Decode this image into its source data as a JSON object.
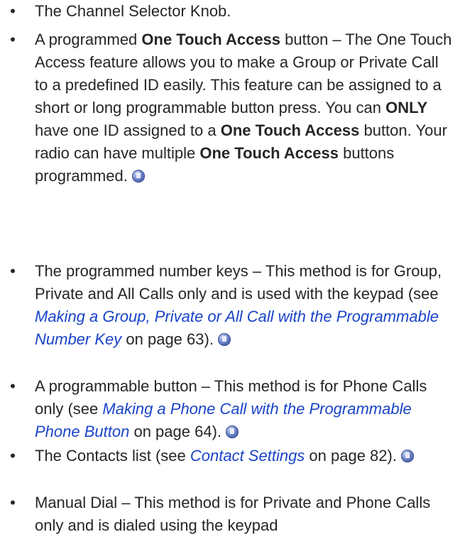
{
  "bullet_char": "•",
  "items": [
    {
      "segments": [
        {
          "t": "n",
          "text": "The Channel Selector Knob."
        }
      ],
      "icon": false
    },
    {
      "segments": [
        {
          "t": "n",
          "text": "A programmed "
        },
        {
          "t": "b",
          "text": "One Touch Access"
        },
        {
          "t": "n",
          "text": " button – The One Touch Access feature allows you to make a Group or Private Call to a predefined ID easily. This feature can be assigned to a short or long programmable button press. You can "
        },
        {
          "t": "b",
          "text": "ONLY"
        },
        {
          "t": "n",
          "text": " have one ID assigned to a "
        },
        {
          "t": "b",
          "text": "One Touch Access"
        },
        {
          "t": "n",
          "text": " button. Your radio can have multiple "
        },
        {
          "t": "b",
          "text": "One Touch Access"
        },
        {
          "t": "n",
          "text": " buttons programmed."
        }
      ],
      "icon": true
    },
    {
      "segments": [
        {
          "t": "n",
          "text": "The programmed number keys – This method is for Group, Private and All Calls only and is used with the keypad (see "
        },
        {
          "t": "l",
          "text": "Making a Group, Private or All Call with the Programmable Number Key"
        },
        {
          "t": "n",
          "text": " on page 63)."
        }
      ],
      "icon": true
    },
    {
      "segments": [
        {
          "t": "n",
          "text": "A programmable button – This method is for Phone Calls only (see "
        },
        {
          "t": "l",
          "text": "Making a Phone Call with the Programmable Phone Button"
        },
        {
          "t": "n",
          "text": " on page 64)."
        }
      ],
      "icon": true
    },
    {
      "segments": [
        {
          "t": "n",
          "text": "The Contacts list (see "
        },
        {
          "t": "l",
          "text": "Contact Settings"
        },
        {
          "t": "n",
          "text": " on page 82)."
        }
      ],
      "icon": true
    },
    {
      "segments": [
        {
          "t": "n",
          "text": "Manual Dial – This method is for Private and Phone Calls only and is dialed using the keypad"
        }
      ],
      "icon": false
    }
  ],
  "colors": {
    "text": "#262626",
    "link": "#1a44c8"
  },
  "icons": {
    "item_marker": "radio-icon"
  }
}
